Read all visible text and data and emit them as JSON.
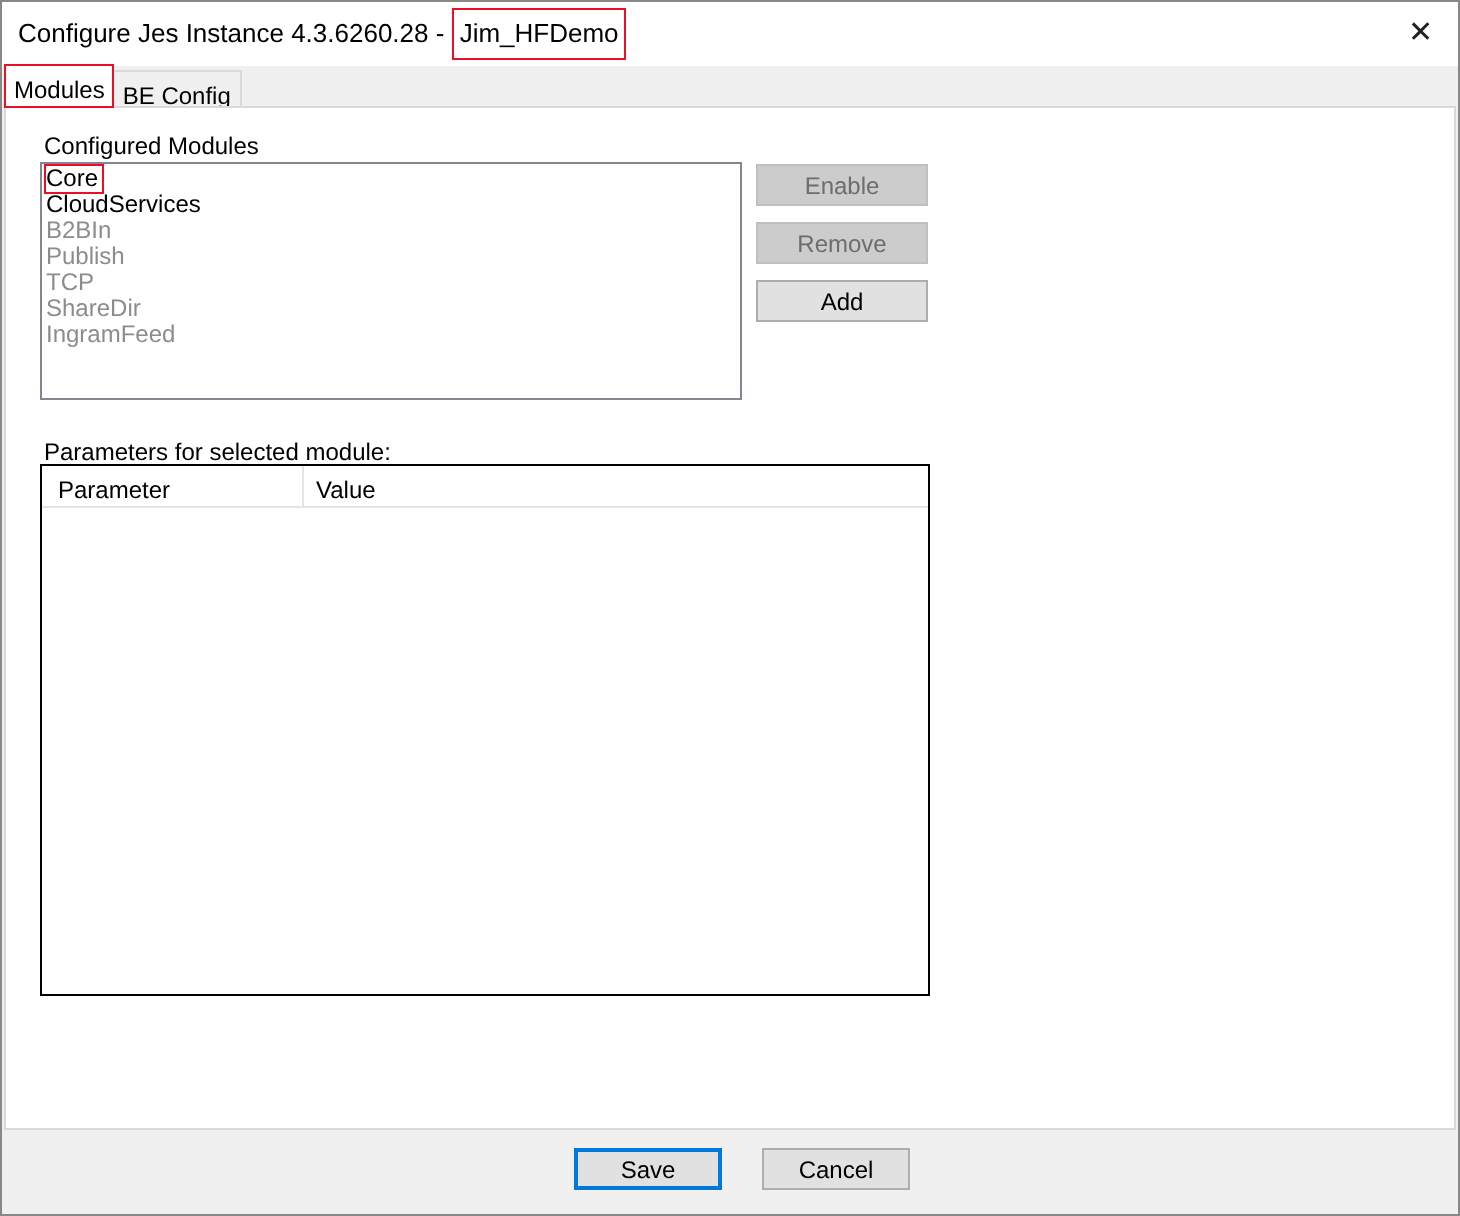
{
  "window": {
    "title_parts": [
      {
        "text": "Configure Jes Instance 4.3.6260.28 - ",
        "highlighted": false
      },
      {
        "text": "Jim_HFDemo",
        "highlighted": true
      }
    ],
    "close": "✕"
  },
  "tabs": [
    {
      "label": "Modules",
      "selected": true,
      "highlighted": true
    },
    {
      "label": "BE Config",
      "selected": false,
      "highlighted": false
    }
  ],
  "modules": {
    "label": "Configured Modules",
    "items": [
      {
        "name": "Core",
        "enabled": true,
        "highlighted": true
      },
      {
        "name": "CloudServices",
        "enabled": true,
        "highlighted": false
      },
      {
        "name": "B2BIn",
        "enabled": false,
        "highlighted": false
      },
      {
        "name": "Publish",
        "enabled": false,
        "highlighted": false
      },
      {
        "name": "TCP",
        "enabled": false,
        "highlighted": false
      },
      {
        "name": "ShareDir",
        "enabled": false,
        "highlighted": false
      },
      {
        "name": "IngramFeed",
        "enabled": false,
        "highlighted": false
      }
    ],
    "buttons": [
      {
        "label": "Enable",
        "disabled": true
      },
      {
        "label": "Remove",
        "disabled": true
      },
      {
        "label": "Add",
        "disabled": false
      }
    ]
  },
  "parameters": {
    "label": "Parameters for selected module:",
    "columns": [
      "Parameter",
      "Value"
    ]
  },
  "footer_buttons": [
    {
      "label": "Save",
      "default": true
    },
    {
      "label": "Cancel",
      "default": false
    }
  ]
}
